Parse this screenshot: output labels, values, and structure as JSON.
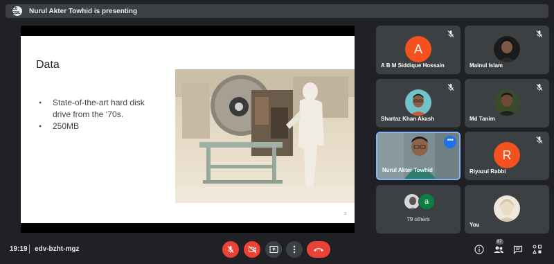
{
  "banner": {
    "logo_text": "CS CGIL",
    "text": "Nurul Akter Towhid is presenting"
  },
  "slide": {
    "title": "Data",
    "bullets": [
      "State-of-the-art hard disk drive from the ‘70s.",
      "250MB"
    ],
    "page_number": "3"
  },
  "participants": [
    {
      "name": "A B M Siddique Hossain",
      "avatar_letter": "A",
      "avatar_color": "#f4511e",
      "muted": true
    },
    {
      "name": "Mainul Islam",
      "avatar": "photo",
      "muted": true
    },
    {
      "name": "Shartaz Khan Akash",
      "avatar": "photo",
      "muted": true
    },
    {
      "name": "Md Tanim",
      "avatar": "photo",
      "muted": true
    },
    {
      "name": "Nurul Akter Towhid",
      "avatar": "video",
      "muted": false,
      "active": true
    },
    {
      "name": "Riyazul Rabbi",
      "avatar_letter": "R",
      "avatar_color": "#f4511e",
      "muted": true
    },
    {
      "others_label": "79 others",
      "others_letter": "a",
      "others_color": "#0b8043"
    },
    {
      "name": "You",
      "avatar": "photo",
      "muted": false
    }
  ],
  "bottom_bar": {
    "time": "19:19",
    "meeting_code": "edv-bzht-mgz",
    "people_count": "87"
  },
  "colors": {
    "accent_red": "#ea4335",
    "accent_blue": "#1a73e8",
    "tile_bg": "#3c4043",
    "page_bg": "#202124"
  }
}
